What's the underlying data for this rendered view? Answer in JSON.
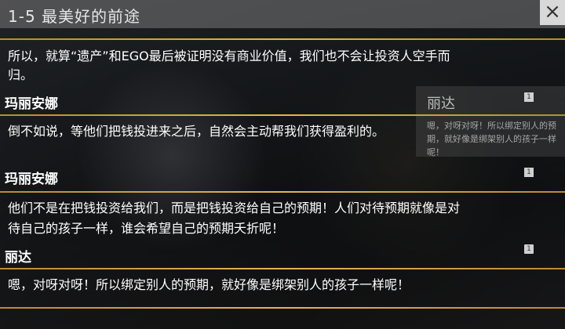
{
  "header": {
    "title": "1-5 最美好的前途",
    "close_icon": "close-icon"
  },
  "side_card": {
    "speaker": "丽达",
    "text": "嗯，对呀对呀！所以绑定别人的预期，就好像是绑架别人的孩子一样呢！",
    "count": "1",
    "count2": "1"
  },
  "dialogue": [
    {
      "speaker": "",
      "lines": [
        "所以，就算“遗产”和EGO最后被证明没有商业价值，我们也不会让投资人空手而",
        "归。"
      ],
      "count": ""
    },
    {
      "speaker": "玛丽安娜",
      "lines": [
        "倒不如说，等他们把钱投进来之后，自然会主动帮我们获得盈利的。"
      ],
      "count": "1"
    },
    {
      "speaker": "玛丽安娜",
      "lines": [
        "他们不是在把钱投资给我们，而是把钱投资给自己的预期！人们对待预期就像是对",
        "待自己的孩子一样，谁会希望自己的预期夭折呢！"
      ],
      "count": "1"
    },
    {
      "speaker": "丽达",
      "lines": [
        "嗯，对呀对呀！所以绑定别人的预期，就好像是绑架别人的孩子一样呢！"
      ],
      "count": "1"
    }
  ],
  "colors": {
    "divider": "#e2b64d",
    "text": "#ffffff"
  }
}
